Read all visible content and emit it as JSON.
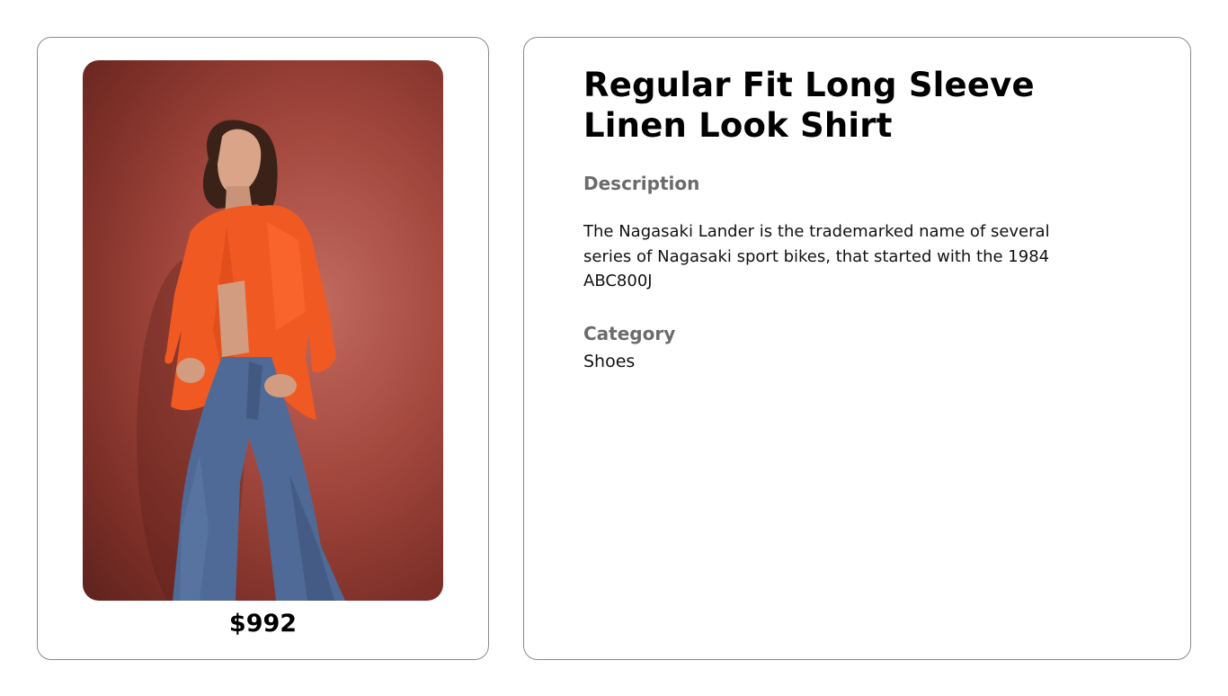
{
  "product": {
    "title": "Regular Fit Long Sleeve Linen Look Shirt",
    "price": "$992",
    "image_alt": "model-wearing-orange-linen-shirt-and-wide-leg-jeans",
    "description_label": "Description",
    "description": "The Nagasaki Lander is the trademarked name of several series of Nagasaki sport bikes, that started with the 1984 ABC800J",
    "category_label": "Category",
    "category": "Shoes"
  },
  "colors": {
    "background_brand": "#a5493f",
    "shirt": "#f05a22",
    "jeans": "#4f6a96",
    "muted_label": "#6b6b6b",
    "border": "#8a8a8a"
  }
}
